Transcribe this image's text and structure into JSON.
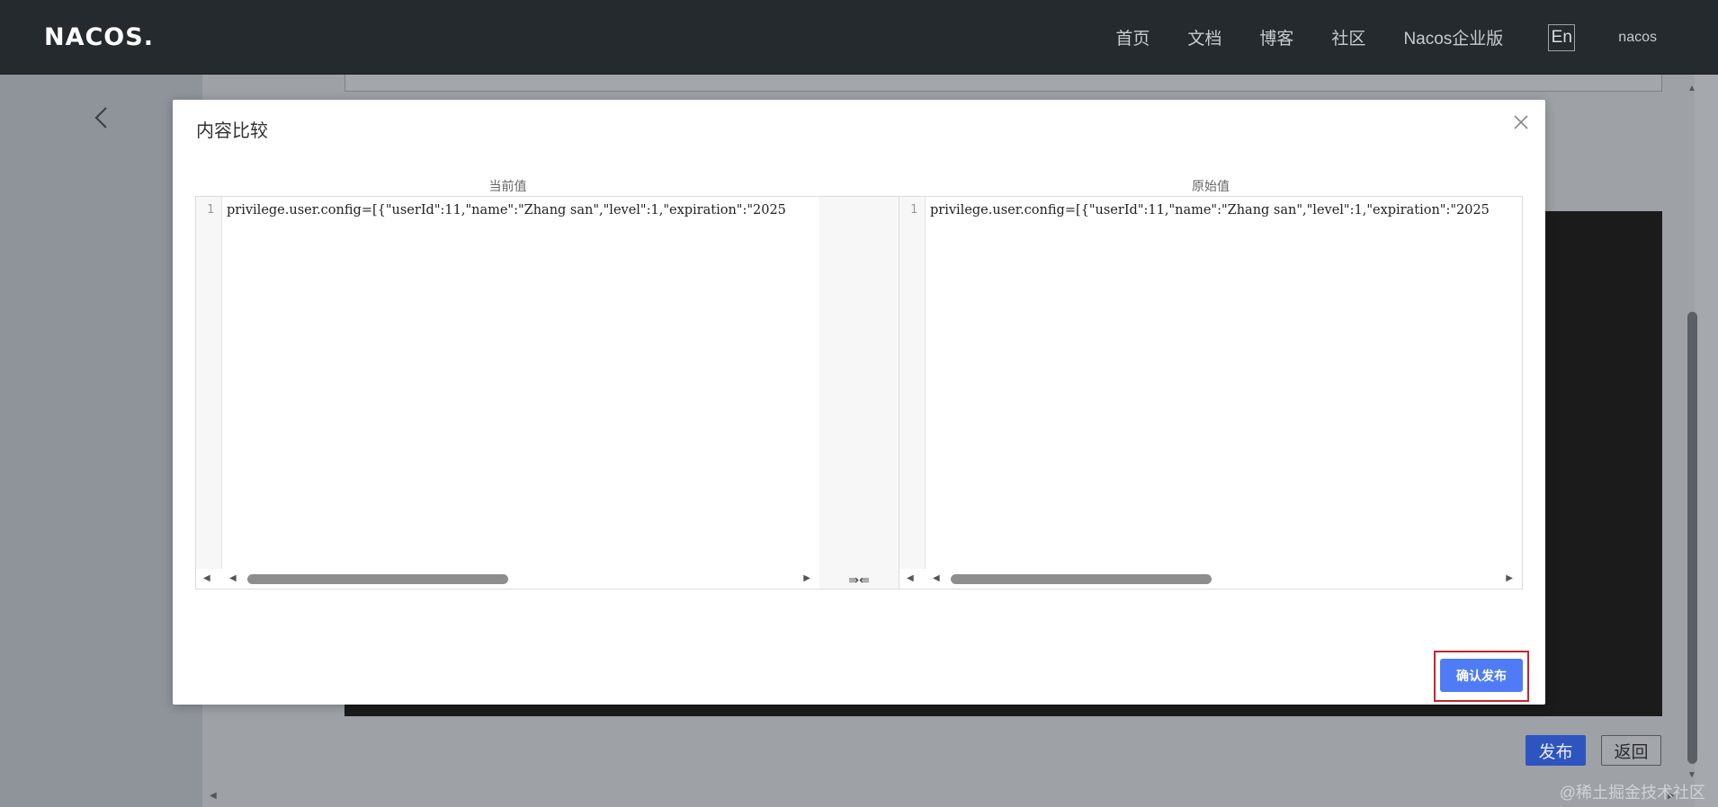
{
  "navbar": {
    "logo_text": "NACOS.",
    "links": [
      "首页",
      "文档",
      "博客",
      "社区",
      "Nacos企业版"
    ],
    "lang_button": "En",
    "user": "nacos"
  },
  "background_page": {
    "publish_button": "发布",
    "return_button": "返回",
    "watermark": "@稀土掘金技术社区"
  },
  "modal": {
    "title": "内容比较",
    "left_pane": {
      "label": "当前值",
      "line_number": "1",
      "content": "privilege.user.config=[{\"userId\":11,\"name\":\"Zhang san\",\"level\":1,\"expiration\":\"2025"
    },
    "right_pane": {
      "label": "原始值",
      "line_number": "1",
      "content": "privilege.user.config=[{\"userId\":11,\"name\":\"Zhang san\",\"level\":1,\"expiration\":\"2025"
    },
    "merge_icon": "⇛⇚",
    "confirm_button": "确认发布"
  },
  "colors": {
    "navbar_bg": "#252a2f",
    "primary": "#4f7cf5",
    "highlight_border": "#c8242b"
  }
}
